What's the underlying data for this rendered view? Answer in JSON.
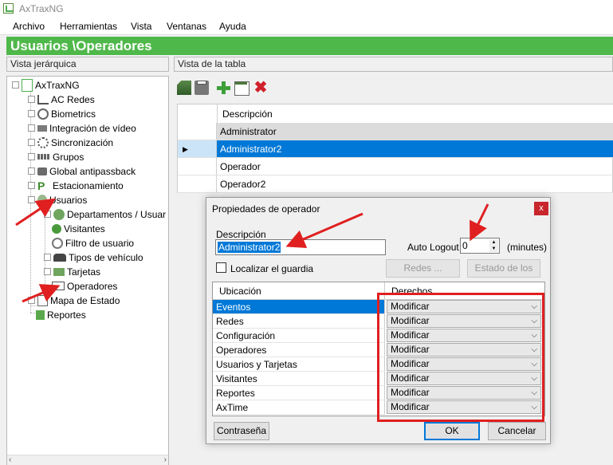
{
  "app": {
    "title": "AxTraxNG"
  },
  "menu": [
    "Archivo",
    "Herramientas",
    "Vista",
    "Ventanas",
    "Ayuda"
  ],
  "banner": "Usuarios  \\Operadores",
  "panels": {
    "tree_header": "Vista jerárquica",
    "table_header": "Vista de la tabla"
  },
  "tree": {
    "root": "AxTraxNG",
    "items": [
      "AC Redes",
      "Biometrics",
      "Integración de vídeo",
      "Sincronización",
      "Grupos",
      "Global antipassback",
      "Estacionamiento",
      "Usuarios"
    ],
    "usuarios_children": [
      "Departamentos / Usuar",
      "Visitantes",
      "Filtro de usuario",
      "Tipos de vehículo",
      "Tarjetas",
      "Operadores"
    ],
    "after": [
      "Mapa de Estado",
      "Reportes"
    ]
  },
  "grid": {
    "column": "Descripción",
    "rows": [
      "Administrator",
      "Administrator2",
      "Operador",
      "Operador2"
    ]
  },
  "dialog": {
    "title": "Propiedades de operador",
    "close": "x",
    "desc_label": "Descripción",
    "desc_value": "Administrator2",
    "auto_logout_label": "Auto Logout :",
    "auto_logout_value": "0",
    "minutes": "(minutes)",
    "guard_label": "Localizar el guardia",
    "redes_btn": "Redes ...",
    "estado_btn": "Estado de los",
    "col_location": "Ubicación",
    "col_rights": "Derechos",
    "permissions": [
      {
        "location": "Eventos",
        "right": "Modificar"
      },
      {
        "location": "Redes",
        "right": "Modificar"
      },
      {
        "location": "Configuración",
        "right": "Modificar"
      },
      {
        "location": "Operadores",
        "right": "Modificar"
      },
      {
        "location": "Usuarios y Tarjetas",
        "right": "Modificar"
      },
      {
        "location": "Visitantes",
        "right": "Modificar"
      },
      {
        "location": "Reportes",
        "right": "Modificar"
      },
      {
        "location": "AxTime",
        "right": "Modificar"
      }
    ],
    "password_btn": "Contraseña",
    "ok_btn": "OK",
    "cancel_btn": "Cancelar"
  },
  "colors": {
    "banner": "#4fb84a",
    "selection": "#0078d7",
    "highlight": "#e02020"
  }
}
